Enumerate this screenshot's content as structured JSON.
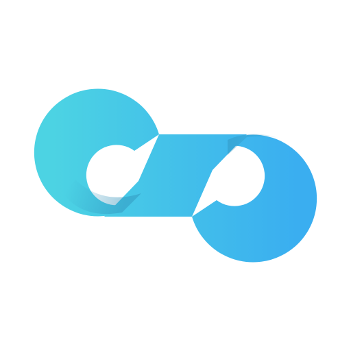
{
  "logo": {
    "icon": "infinity-loop-icon",
    "colors": {
      "background": "#ffffff",
      "gradient_start": "#4CD3E3",
      "gradient_end": "#3AAEF0",
      "shadow": "#2E8FB8"
    }
  }
}
